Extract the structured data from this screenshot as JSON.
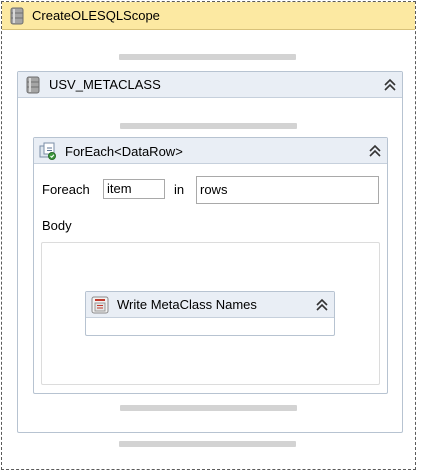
{
  "outer": {
    "title": "CreateOLESQLScope",
    "icon": "database-icon",
    "header_color": "#fce9a2"
  },
  "sequence": {
    "title": "USV_METACLASS",
    "icon": "database-icon"
  },
  "foreach": {
    "title": "ForEach<DataRow>",
    "icon": "foreach-icon",
    "foreach_label": "Foreach",
    "item_value": "item",
    "in_label": "in",
    "collection_value": "rows",
    "body_label": "Body"
  },
  "write_activity": {
    "title": "Write MetaClass Names",
    "icon": "write-line-icon"
  }
}
